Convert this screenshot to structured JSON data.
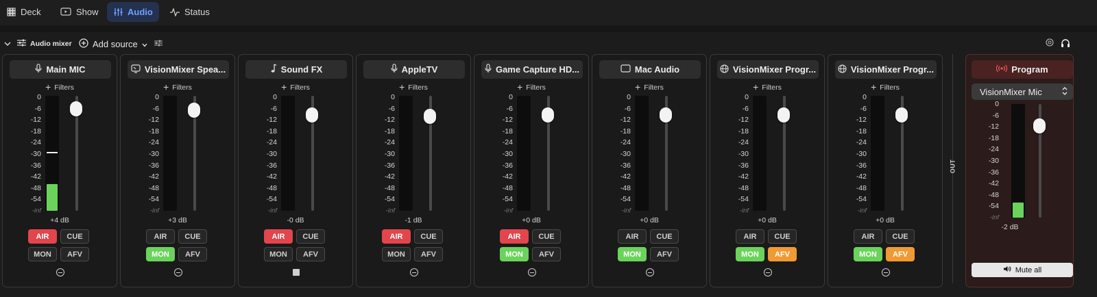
{
  "tabs": [
    {
      "label": "Deck",
      "icon": "grid-icon",
      "active": false
    },
    {
      "label": "Show",
      "icon": "play-screen-icon",
      "active": false
    },
    {
      "label": "Audio",
      "icon": "sliders-icon",
      "active": true
    },
    {
      "label": "Status",
      "icon": "pulse-icon",
      "active": false
    }
  ],
  "toolbar": {
    "collapse_icon": "chevron-down-icon",
    "section_label": "Audio mixer",
    "add_source_label": "Add source",
    "right_icons": [
      "target-icon",
      "headphones-icon"
    ]
  },
  "scale_labels": [
    "0",
    "-6",
    "-12",
    "-18",
    "-24",
    "-30",
    "-36",
    "-42",
    "-48",
    "-54",
    "-inf"
  ],
  "channels": [
    {
      "name": "Main MIC",
      "icon": "microphone-icon",
      "filters_label": "Filters",
      "gain": "+4 dB",
      "fader_level_db": 4,
      "meter_level_db": -46,
      "peak_db": -30,
      "air": true,
      "cue": false,
      "mon": false,
      "afv": false,
      "footer": "minus",
      "labels": {
        "air": "AIR",
        "cue": "CUE",
        "mon": "MON",
        "afv": "AFV"
      }
    },
    {
      "name": "VisionMixer Spea...",
      "icon": "screen-audio-icon",
      "filters_label": "Filters",
      "gain": "+3 dB",
      "fader_level_db": 3,
      "meter_level_db": null,
      "air": false,
      "cue": false,
      "mon": true,
      "afv": false,
      "footer": "minus",
      "labels": {
        "air": "AIR",
        "cue": "CUE",
        "mon": "MON",
        "afv": "AFV"
      }
    },
    {
      "name": "Sound FX",
      "icon": "music-note-icon",
      "filters_label": "Filters",
      "gain": "-0 dB",
      "fader_level_db": 0,
      "meter_level_db": null,
      "air": true,
      "cue": false,
      "mon": false,
      "afv": false,
      "footer": "square",
      "labels": {
        "air": "AIR",
        "cue": "CUE",
        "mon": "MON",
        "afv": "AFV"
      }
    },
    {
      "name": "AppleTV",
      "icon": "microphone-icon",
      "filters_label": "Filters",
      "gain": "-1 dB",
      "fader_level_db": -1,
      "meter_level_db": null,
      "air": true,
      "cue": false,
      "mon": false,
      "afv": false,
      "footer": "minus",
      "labels": {
        "air": "AIR",
        "cue": "CUE",
        "mon": "MON",
        "afv": "AFV"
      }
    },
    {
      "name": "Game Capture HD...",
      "icon": "microphone-icon",
      "filters_label": "Filters",
      "gain": "+0 dB",
      "fader_level_db": 0,
      "meter_level_db": null,
      "air": true,
      "cue": false,
      "mon": true,
      "afv": false,
      "footer": "minus",
      "labels": {
        "air": "AIR",
        "cue": "CUE",
        "mon": "MON",
        "afv": "AFV"
      }
    },
    {
      "name": "Mac Audio",
      "icon": "display-icon",
      "filters_label": "Filters",
      "gain": "+0 dB",
      "fader_level_db": 0,
      "meter_level_db": null,
      "air": false,
      "cue": false,
      "mon": true,
      "afv": false,
      "footer": "minus",
      "labels": {
        "air": "AIR",
        "cue": "CUE",
        "mon": "MON",
        "afv": "AFV"
      }
    },
    {
      "name": "VisionMixer Progr...",
      "icon": "globe-icon",
      "filters_label": "Filters",
      "gain": "+0 dB",
      "fader_level_db": 0,
      "meter_level_db": null,
      "air": false,
      "cue": false,
      "mon": true,
      "afv": true,
      "footer": "minus",
      "labels": {
        "air": "AIR",
        "cue": "CUE",
        "mon": "MON",
        "afv": "AFV"
      }
    },
    {
      "name": "VisionMixer Progr...",
      "icon": "globe-icon",
      "filters_label": "Filters",
      "gain": "+0 dB",
      "fader_level_db": 0,
      "meter_level_db": null,
      "air": false,
      "cue": false,
      "mon": true,
      "afv": true,
      "footer": "minus",
      "labels": {
        "air": "AIR",
        "cue": "CUE",
        "mon": "MON",
        "afv": "AFV"
      }
    }
  ],
  "out_label": "OUT",
  "program": {
    "name": "Program",
    "icon": "broadcast-icon",
    "output_device": "VisionMixer Mic",
    "gain": "-2 dB",
    "fader_level_db": -2,
    "meter_level_db": -52,
    "mute_all_label": "Mute all",
    "mute_icon": "speaker-icon"
  },
  "colors": {
    "air_on": "#e2454b",
    "mon_on": "#6bd35c",
    "afv_on": "#f09a33",
    "tab_active_text": "#6fa0ff",
    "program_bg": "#2b1b1b"
  }
}
